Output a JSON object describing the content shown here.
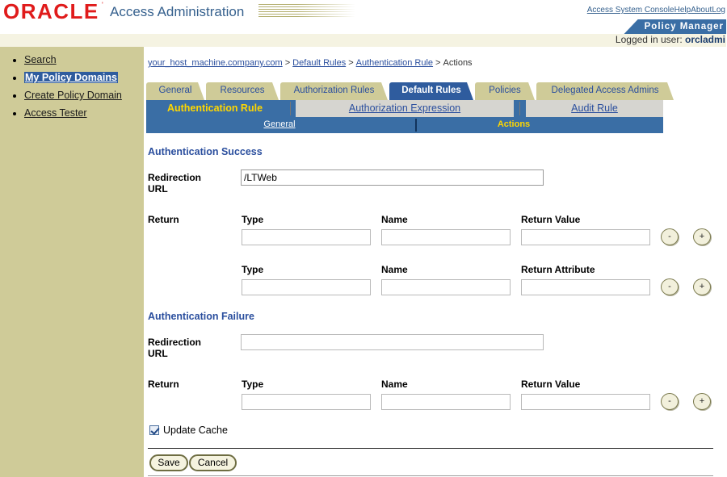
{
  "brand": {
    "logo_text": "ORACLE",
    "trademark": "'",
    "app_title": "Access Administration",
    "stripes_icon": "striped-decoration"
  },
  "header": {
    "links": [
      {
        "label": "Access System Console"
      },
      {
        "label": "Help"
      },
      {
        "label": "About"
      },
      {
        "label": "Log"
      }
    ],
    "product_tab": "Policy Manager",
    "logged_in_prefix": "Logged in user: ",
    "logged_in_user": "orcladmi"
  },
  "sidebar": {
    "items": [
      {
        "label": "Search",
        "selected": false
      },
      {
        "label": "My Policy Domains",
        "selected": true
      },
      {
        "label": "Create Policy Domain",
        "selected": false
      },
      {
        "label": "Access Tester",
        "selected": false
      }
    ]
  },
  "breadcrumb": {
    "items": [
      {
        "label": "your_host_machine.company.com",
        "link": true
      },
      {
        "label": "Default Rules",
        "link": true
      },
      {
        "label": "Authentication Rule",
        "link": true
      },
      {
        "label": "Actions",
        "link": false
      }
    ],
    "separator": ">"
  },
  "tabs": {
    "primary": [
      {
        "label": "General",
        "active": false
      },
      {
        "label": "Resources",
        "active": false
      },
      {
        "label": "Authorization Rules",
        "active": false
      },
      {
        "label": "Default Rules",
        "active": true
      },
      {
        "label": "Policies",
        "active": false
      },
      {
        "label": "Delegated Access Admins",
        "active": false
      }
    ],
    "secondary": [
      {
        "label": "Authentication Rule",
        "active": true
      },
      {
        "label": "Authorization Expression",
        "active": false
      },
      {
        "label": "Audit Rule",
        "active": false
      }
    ],
    "tertiary": [
      {
        "label": "General",
        "active": false
      },
      {
        "label": "Actions",
        "active": true
      }
    ]
  },
  "form": {
    "success": {
      "heading": "Authentication Success",
      "redirection_label_line1": "Redirection",
      "redirection_label_line2": "URL",
      "redirection_value": "/LTWeb",
      "return_label": "Return",
      "row1": {
        "col_type": "Type",
        "col_name": "Name",
        "col_value": "Return Value",
        "type_value": "",
        "name_value": "",
        "value_value": "",
        "minus": "-",
        "plus": "+"
      },
      "row2": {
        "col_type": "Type",
        "col_name": "Name",
        "col_value": "Return Attribute",
        "type_value": "",
        "name_value": "",
        "value_value": "",
        "minus": "-",
        "plus": "+"
      }
    },
    "failure": {
      "heading": "Authentication Failure",
      "redirection_label_line1": "Redirection",
      "redirection_label_line2": "URL",
      "redirection_value": "",
      "return_label": "Return",
      "row1": {
        "col_type": "Type",
        "col_name": "Name",
        "col_value": "Return Value",
        "type_value": "",
        "name_value": "",
        "value_value": "",
        "minus": "-",
        "plus": "+"
      }
    },
    "update_cache_label": "Update Cache",
    "update_cache_checked": true,
    "save_label": "Save",
    "cancel_label": "Cancel"
  }
}
